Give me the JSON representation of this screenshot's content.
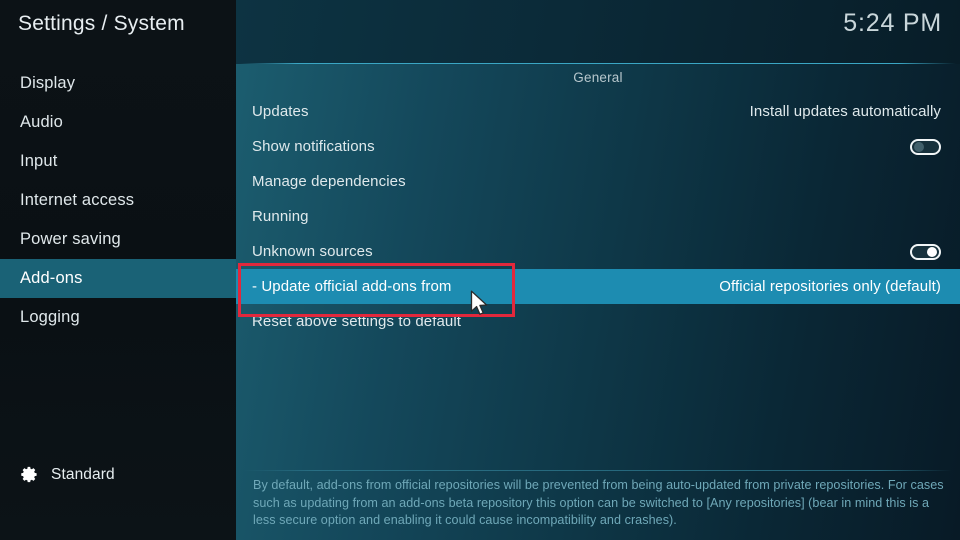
{
  "window": {
    "title": "Settings / System",
    "clock": "5:24 PM"
  },
  "sidebar": {
    "items": [
      {
        "label": "Display",
        "selected": false
      },
      {
        "label": "Audio",
        "selected": false
      },
      {
        "label": "Input",
        "selected": false
      },
      {
        "label": "Internet access",
        "selected": false
      },
      {
        "label": "Power saving",
        "selected": false
      },
      {
        "label": "Add-ons",
        "selected": true
      },
      {
        "label": "Logging",
        "selected": false
      }
    ],
    "level": {
      "icon": "gear-icon",
      "label": "Standard"
    }
  },
  "main": {
    "group_title": "General",
    "rows": [
      {
        "label": "Updates",
        "value": "Install updates automatically",
        "control": "text",
        "selected": false
      },
      {
        "label": "Show notifications",
        "value": "",
        "control": "toggle",
        "toggle": "off",
        "selected": false
      },
      {
        "label": "Manage dependencies",
        "value": "",
        "control": "none",
        "selected": false
      },
      {
        "label": "Running",
        "value": "",
        "control": "none",
        "selected": false
      },
      {
        "label": "Unknown sources",
        "value": "",
        "control": "toggle",
        "toggle": "on",
        "selected": false
      },
      {
        "label": "- Update official add-ons from",
        "value": "Official repositories only (default)",
        "control": "text",
        "selected": true
      },
      {
        "label": "Reset above settings to default",
        "value": "",
        "control": "none",
        "selected": false
      }
    ],
    "help_text": "By default, add-ons from official repositories will be prevented from being auto-updated from private repositories. For cases such as updating from an add-ons beta repository this option can be switched to [Any repositories] (bear in mind this is a less secure option and enabling it could cause incompatibility and crashes)."
  },
  "annotation": {
    "highlight_color": "#e2283c",
    "cursor": "mouse-pointer"
  },
  "colors": {
    "selected_row": "#1d8cb1",
    "selected_sidebar": "#1a6276",
    "accent_rule": "#3aa6c4",
    "help_text": "#6fa8b8"
  }
}
